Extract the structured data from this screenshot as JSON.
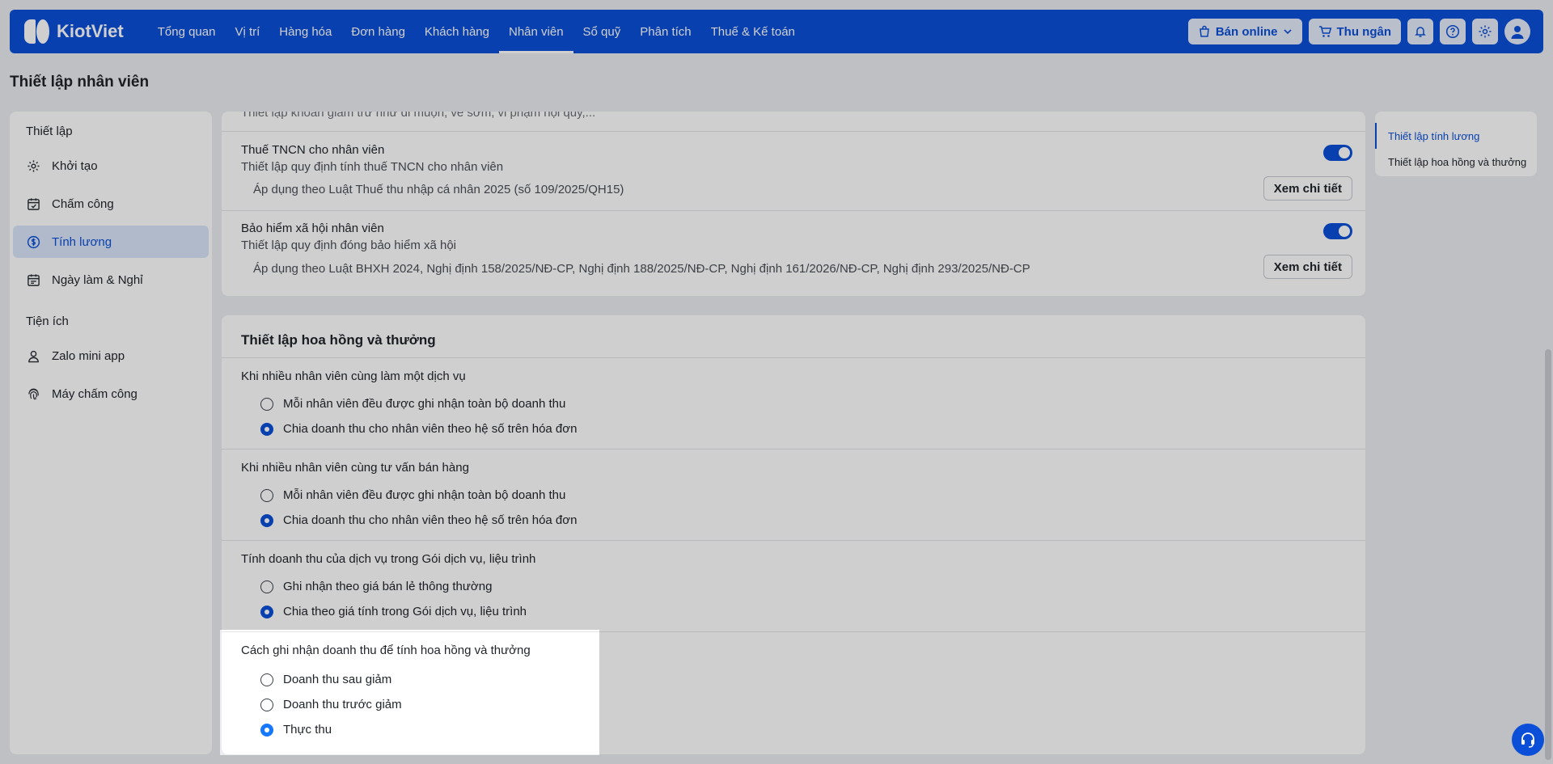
{
  "brand": "KiotViet",
  "nav": [
    "Tổng quan",
    "Vị trí",
    "Hàng hóa",
    "Đơn hàng",
    "Khách hàng",
    "Nhân viên",
    "Sổ quỹ",
    "Phân tích",
    "Thuế & Kế toán"
  ],
  "nav_active": "Nhân viên",
  "top_actions": {
    "online": "Bán online",
    "cashier": "Thu ngân"
  },
  "page_title": "Thiết lập nhân viên",
  "sidebar": {
    "section1": "Thiết lập",
    "items": [
      {
        "label": "Khởi tạo",
        "icon": "gear-icon"
      },
      {
        "label": "Chấm công",
        "icon": "calendar-check-icon"
      },
      {
        "label": "Tính lương",
        "icon": "dollar-circle-icon",
        "active": true
      },
      {
        "label": "Ngày làm & Nghỉ",
        "icon": "calendar-icon"
      }
    ],
    "section2": "Tiện ích",
    "items2": [
      {
        "label": "Zalo mini app",
        "icon": "person-icon"
      },
      {
        "label": "Máy chấm công",
        "icon": "fingerprint-icon"
      }
    ]
  },
  "salary": {
    "cut_text": "Thiết lập khoản giảm trừ như đi muộn, về sớm, vi phạm nội quy,...",
    "tax": {
      "title": "Thuế TNCN cho nhân viên",
      "sub": "Thiết lập quy định tính thuế TNCN cho nhân viên",
      "apply": "Áp dụng theo Luật Thuế thu nhập cá nhân 2025 (số 109/2025/QH15)",
      "button": "Xem chi tiết"
    },
    "insurance": {
      "title": "Bảo hiểm xã hội nhân viên",
      "sub": "Thiết lập quy định đóng bảo hiểm xã hội",
      "apply": "Áp dụng theo Luật BHXH 2024, Nghị định 158/2025/NĐ-CP, Nghị định 188/2025/NĐ-CP, Nghị định 161/2026/NĐ-CP, Nghị định 293/2025/NĐ-CP",
      "button": "Xem chi tiết"
    }
  },
  "commission": {
    "title": "Thiết lập hoa hồng và thưởng",
    "groups": [
      {
        "title": "Khi nhiều nhân viên cùng làm một dịch vụ",
        "options": [
          "Mỗi nhân viên đều được ghi nhận toàn bộ doanh thu",
          "Chia doanh thu cho nhân viên theo hệ số trên hóa đơn"
        ],
        "selected": 1
      },
      {
        "title": "Khi nhiều nhân viên cùng tư vấn bán hàng",
        "options": [
          "Mỗi nhân viên đều được ghi nhận toàn bộ doanh thu",
          "Chia doanh thu cho nhân viên theo hệ số trên hóa đơn"
        ],
        "selected": 1
      },
      {
        "title": "Tính doanh thu của dịch vụ trong Gói dịch vụ, liệu trình",
        "options": [
          "Ghi nhận theo giá bán lẻ thông thường",
          "Chia theo giá tính trong Gói dịch vụ, liệu trình"
        ],
        "selected": 1
      },
      {
        "title": "Cách ghi nhận doanh thu để tính hoa hồng và thưởng",
        "options": [
          "Doanh thu sau giảm",
          "Doanh thu trước giảm",
          "Thực thu"
        ],
        "selected": 2
      }
    ]
  },
  "anchor": [
    "Thiết lập tính lương",
    "Thiết lập hoa hồng và thưởng"
  ]
}
